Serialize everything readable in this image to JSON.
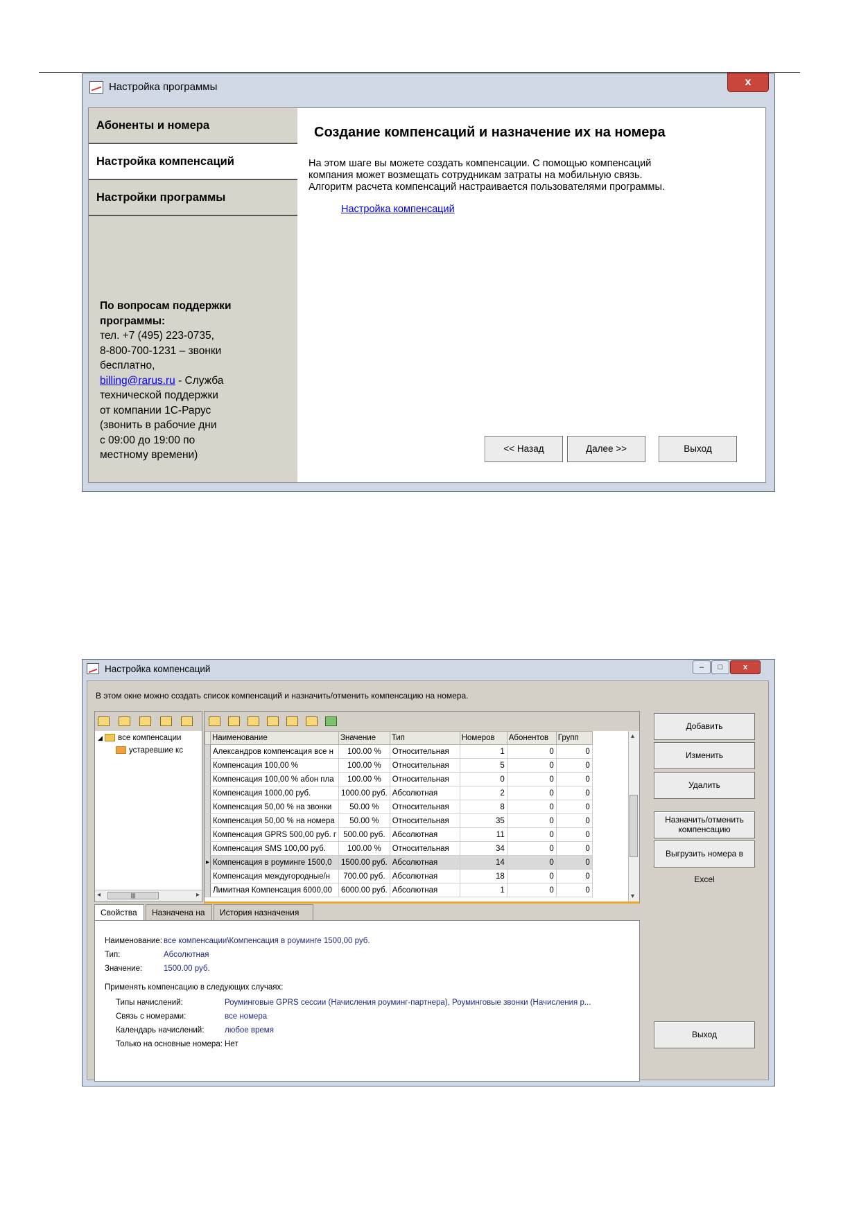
{
  "window1": {
    "title": "Настройка программы",
    "close_label": "x",
    "nav": [
      {
        "label": "Абоненты и номера"
      },
      {
        "label": "Настройка компенсаций"
      },
      {
        "label": "Настройки программы"
      }
    ],
    "support": {
      "heading": "По вопросам поддержки программы:",
      "phone_line": "тел. +7 (495) 223-0735,",
      "free_line_1": "8-800-700-1231 – звонки",
      "free_line_2": "бесплатно,",
      "email": "billing@rarus.ru",
      "email_suffix": " - Служба",
      "line_a": "технической поддержки",
      "line_b": "от компании 1С-Рарус",
      "line_c": "(звонить в рабочие дни",
      "line_d": "с 09:00 до 19:00 по",
      "line_e": "местному времени)"
    },
    "heading": "Создание компенсаций и назначение их на номера",
    "description_1": "На этом шаге вы можете создать компенсации. С помощью компенсаций",
    "description_2": "компания может возмещать сотрудникам затраты на мобильную связь.",
    "description_3": "Алгоритм расчета компенсаций настраивается пользователями программы.",
    "link": "Настройка компенсаций",
    "buttons": {
      "back": "<< Назад",
      "next": "Далее >>",
      "exit": "Выход"
    }
  },
  "window2": {
    "title": "Настройка компенсаций",
    "window_buttons": {
      "minimize": "–",
      "maximize": "□",
      "close": "x"
    },
    "intro": "В этом окне можно создать список компенсаций и назначить/отменить компенсацию на номера.",
    "tree": [
      {
        "label": "все компенсации"
      },
      {
        "label": "устаревшие кс"
      }
    ],
    "grid": {
      "columns": [
        "Наименование",
        "Значение",
        "Тип",
        "Номеров",
        "Абонентов",
        "Групп"
      ],
      "rows": [
        [
          "Александров компенсация все н",
          "100.00 %",
          "Относительная",
          "1",
          "0",
          "0"
        ],
        [
          "Компенсация 100,00 %",
          "100.00 %",
          "Относительная",
          "5",
          "0",
          "0"
        ],
        [
          "Компенсация 100,00 % абон пла",
          "100.00 %",
          "Относительная",
          "0",
          "0",
          "0"
        ],
        [
          "Компенсация 1000,00 руб.",
          "1000.00 руб.",
          "Абсолютная",
          "2",
          "0",
          "0"
        ],
        [
          "Компенсация 50,00 % на звонки",
          "50.00 %",
          "Относительная",
          "8",
          "0",
          "0"
        ],
        [
          "Компенсация 50,00 % на номера",
          "50.00 %",
          "Относительная",
          "35",
          "0",
          "0"
        ],
        [
          "Компенсация GPRS 500,00 руб. г",
          "500.00 руб.",
          "Абсолютная",
          "11",
          "0",
          "0"
        ],
        [
          "Компенсация SMS 100,00 руб.",
          "100.00 %",
          "Относительная",
          "34",
          "0",
          "0"
        ],
        [
          "Компенсация в роуминге 1500,0",
          "1500.00 руб.",
          "Абсолютная",
          "14",
          "0",
          "0"
        ],
        [
          "Компенсация междугородные/н",
          "700.00 руб.",
          "Абсолютная",
          "18",
          "0",
          "0"
        ],
        [
          "Лимитная Компенсация 6000,00",
          "6000.00 руб.",
          "Абсолютная",
          "1",
          "0",
          "0"
        ]
      ],
      "selected_row": 8
    },
    "buttons": {
      "add": "Добавить",
      "edit": "Изменить",
      "delete": "Удалить",
      "assign_1": "Назначить/отменить",
      "assign_2": "компенсацию",
      "export": "Выгрузить номера в Excel",
      "exit": "Выход"
    },
    "tabs": [
      "Свойства",
      "Назначена на",
      "История назначения"
    ],
    "properties": {
      "name_label": "Наименование:",
      "name_value": "все компенсации\\Компенсация в роуминге 1500,00 руб.",
      "type_label": "Тип:",
      "type_value": "Абсолютная",
      "value_label": "Значение:",
      "value_value": "1500.00 руб.",
      "apply_heading": "Применять компенсацию в следующих случаях:",
      "charge_types_label": "Типы начислений:",
      "charge_types_value": "Роуминговые GPRS сессии (Начисления роуминг-партнера), Роуминговые звонки (Начисления р...",
      "numbers_label": "Связь с номерами:",
      "numbers_value": "все номера",
      "calendar_label": "Календарь начислений:",
      "calendar_value": "любое время",
      "main_only_label": "Только на основные номера:",
      "main_only_value": "Нет"
    }
  }
}
